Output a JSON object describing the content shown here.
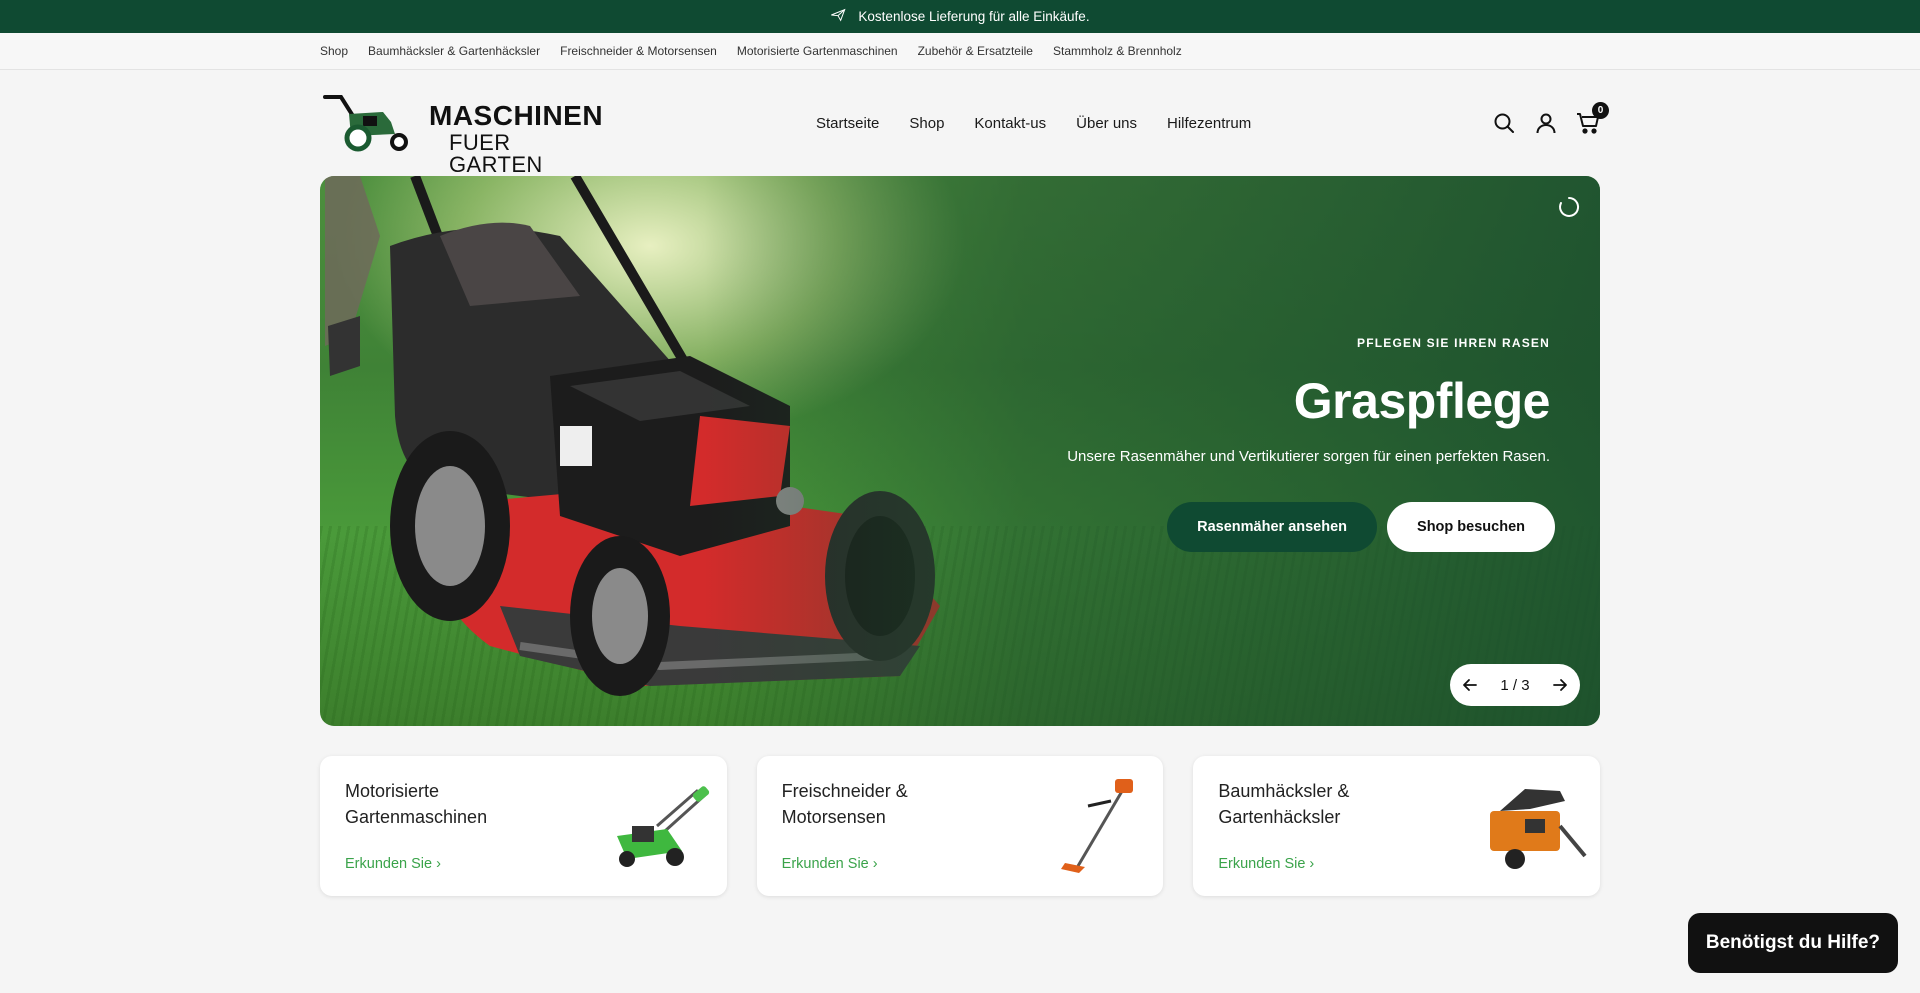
{
  "announcement": {
    "text": "Kostenlose Lieferung für alle Einkäufe.",
    "icon": "plane-icon"
  },
  "subnav": [
    "Shop",
    "Baumhäcksler & Gartenhäcksler",
    "Freischneider & Motorsensen",
    "Motorisierte Gartenmaschinen",
    "Zubehör & Ersatzteile",
    "Stammholz & Brennholz"
  ],
  "logo": {
    "main": "MASCHINEN",
    "sub": "FUER GARTEN"
  },
  "mainnav": [
    "Startseite",
    "Shop",
    "Kontakt-us",
    "Über uns",
    "Hilfezentrum"
  ],
  "header_icons": {
    "search": "search-icon",
    "account": "user-icon",
    "cart": "cart-icon",
    "cart_count": "0"
  },
  "hero": {
    "eyebrow": "PFLEGEN SIE IHREN RASEN",
    "title": "Graspflege",
    "description": "Unsere Rasenmäher und Vertikutierer sorgen für einen perfekten Rasen.",
    "primary_button": "Rasenmäher ansehen",
    "secondary_button": "Shop besuchen",
    "pager": "1 / 3"
  },
  "cards": [
    {
      "title": "Motorisierte Gartenmaschinen",
      "link": "Erkunden Sie"
    },
    {
      "title": "Freischneider & Motorsensen",
      "link": "Erkunden Sie"
    },
    {
      "title": "Baumhäcksler & Gartenhäcksler",
      "link": "Erkunden Sie"
    }
  ],
  "help_button": "Benötigst du Hilfe?",
  "colors": {
    "brand_green": "#0f4a32",
    "link_green": "#3aa34a"
  }
}
